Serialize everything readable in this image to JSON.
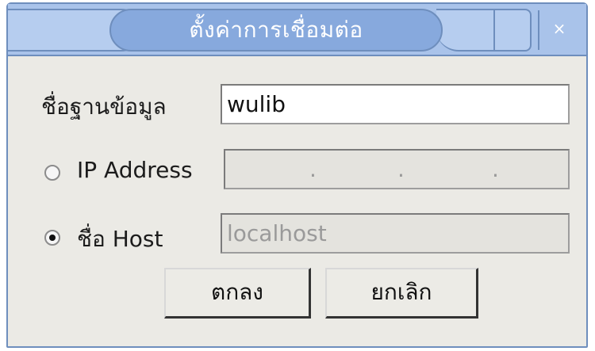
{
  "dialog": {
    "title": "ตั้งค่าการเชื่อมต่อ",
    "close_symbol": "×"
  },
  "form": {
    "database_label": "ชื่อฐานข้อมูล",
    "database_value": "wulib",
    "ip_option_label": "IP Address",
    "ip_selected": false,
    "ip_separators": [
      ".",
      ".",
      "."
    ],
    "host_option_label": "ชื่อ Host",
    "host_selected": true,
    "host_value": "localhost"
  },
  "buttons": {
    "ok_label": "ตกลง",
    "cancel_label": "ยกเลิก"
  }
}
